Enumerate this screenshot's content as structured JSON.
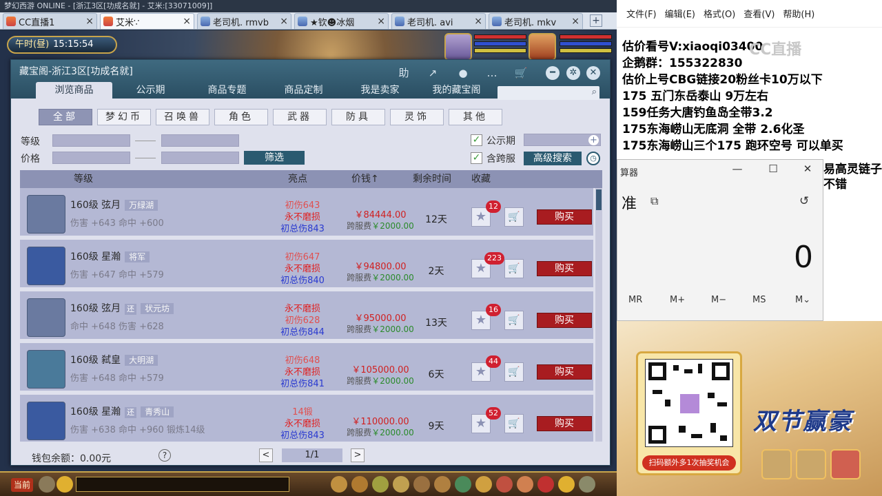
{
  "browser": {
    "top_text": "梦幻西游 ONLINE - [浙江3区[功成名就] - 艾米:[33071009]]",
    "tabs": [
      {
        "label": "CC直播1",
        "close": "×"
      },
      {
        "label": "艾米∵",
        "close": "×"
      },
      {
        "label": "老司机. rmvb",
        "close": "×"
      },
      {
        "label": "★钦☻冰烟",
        "close": "×"
      },
      {
        "label": "老司机. avi",
        "close": "×"
      },
      {
        "label": "老司机. mkv",
        "close": "×"
      }
    ],
    "new_tab": "+"
  },
  "game": {
    "clock_label": "午时(昼)",
    "clock_time": "15:15:54",
    "bottom_now": "当前"
  },
  "cbg": {
    "title": "藏宝阁-浙江3区[功成名就]",
    "header_icons": {
      "help": "助",
      "share": "↗",
      "settings": "●",
      "chat": "…",
      "cart": "🛒"
    },
    "win_controls": {
      "minimize": "━",
      "options": "✲",
      "close": "✕"
    },
    "nav": [
      "浏览商品",
      "公示期",
      "商品专题",
      "商品定制",
      "我是卖家",
      "我的藏宝阁"
    ],
    "search_icon": "⌕",
    "categories": [
      "全部",
      "梦幻币",
      "召唤兽",
      "角色",
      "武器",
      "防具",
      "灵饰",
      "其他"
    ],
    "filter": {
      "level_label": "等级",
      "price_label": "价格",
      "filter_btn": "筛选",
      "public_label": "公示期",
      "cross_label": "含跨服",
      "advanced_btn": "高级搜索",
      "check": "✓",
      "plus": "+",
      "clock": "◷"
    },
    "columns": {
      "level": "等级",
      "highlight": "亮点",
      "price": "价钱↑",
      "remain": "剩余时间",
      "fav": "收藏"
    },
    "rows": [
      {
        "level_name": "160级 弦月",
        "tag2": "",
        "server": "万绿湖",
        "attrs": "伤害 +643 命中 +600",
        "hl": [
          "初伤643",
          "永不磨损",
          "初总伤843"
        ],
        "hl_colors": [
          "#e05050",
          "#e02020",
          "#2a3ad0"
        ],
        "price": "￥84444.00",
        "fee_label": "跨服费",
        "fee": "￥2000.00",
        "time": "12天",
        "fav_count": "12",
        "buy": "购买"
      },
      {
        "level_name": "160级 星瀚",
        "tag2": "",
        "server": "将军",
        "attrs": "伤害 +647 命中 +579",
        "hl": [
          "初伤647",
          "永不磨损",
          "初总伤840"
        ],
        "hl_colors": [
          "#e05050",
          "#e02020",
          "#2a3ad0"
        ],
        "price": "￥94800.00",
        "fee_label": "跨服费",
        "fee": "￥2000.00",
        "time": "2天",
        "fav_count": "223",
        "buy": "购买"
      },
      {
        "level_name": "160级 弦月",
        "tag2": "还",
        "server": "状元坊",
        "attrs": "命中 +648 伤害 +628",
        "hl": [
          "永不磨损",
          "初伤628",
          "初总伤844"
        ],
        "hl_colors": [
          "#e02020",
          "#e05050",
          "#2a3ad0"
        ],
        "price": "￥95000.00",
        "fee_label": "跨服费",
        "fee": "￥2000.00",
        "time": "13天",
        "fav_count": "16",
        "buy": "购买"
      },
      {
        "level_name": "160级 弑皇",
        "tag2": "",
        "server": "大明湖",
        "attrs": "伤害 +648 命中 +579",
        "hl": [
          "初伤648",
          "永不磨损",
          "初总伤841"
        ],
        "hl_colors": [
          "#e05050",
          "#e02020",
          "#2a3ad0"
        ],
        "price": "￥105000.00",
        "fee_label": "跨服费",
        "fee": "￥2000.00",
        "time": "6天",
        "fav_count": "44",
        "buy": "购买"
      },
      {
        "level_name": "160级 星瀚",
        "tag2": "还",
        "server": "青秀山",
        "attrs": "伤害 +638 命中 +960 锻炼14级",
        "hl": [
          "14锻",
          "永不磨损",
          "初总伤843"
        ],
        "hl_colors": [
          "#e05050",
          "#e02020",
          "#2a3ad0"
        ],
        "price": "￥110000.00",
        "fee_label": "跨服费",
        "fee": "￥2000.00",
        "time": "9天",
        "fav_count": "52",
        "buy": "购买"
      }
    ],
    "star": "★",
    "cart": "🛒",
    "wallet": "钱包余额：0.00元",
    "help": "?",
    "prev": "<",
    "next": ">",
    "page": "1/1"
  },
  "notepad": {
    "menu": [
      "文件(F)",
      "编辑(E)",
      "格式(O)",
      "查看(V)",
      "帮助(H)"
    ],
    "lines": [
      "估价看号V:xiaoqi03400",
      "企鹅群：155322830",
      "估价上号CBG链接20粉丝卡10万以下",
      "175 五门东岳泰山  9万左右",
      "159任务大唐钓鱼岛全带3.2",
      "175东海崂山无底洞  全带   2.6化圣",
      "175东海崂山三个175 跑环空号 可以单买"
    ],
    "overflow_lines": [
      "易高灵链子",
      "不错"
    ],
    "watermark": "CC直播"
  },
  "calculator": {
    "title": "算器",
    "minimize": "—",
    "maximize": "☐",
    "close": "✕",
    "mode": "准",
    "mode_icon": "⧉",
    "history_icon": "↺",
    "display": "0",
    "memory": [
      "MR",
      "M+",
      "M−",
      "MS",
      "M⌄"
    ]
  },
  "promo": {
    "qr_caption": "扫码额外多1次抽奖机会",
    "slogan": "双节赢豪"
  }
}
